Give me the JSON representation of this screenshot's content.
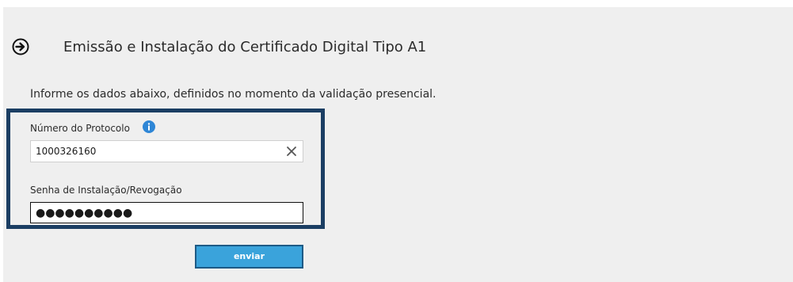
{
  "header": {
    "title": "Emissão e Instalação do Certificado Digital Tipo A1",
    "icon": "arrow-right-circle-icon"
  },
  "instruction": "Informe os dados abaixo, definidos no momento da validação presencial.",
  "form": {
    "protocol": {
      "label": "Número do Protocolo",
      "value": "1000326160",
      "info_icon": "info-icon",
      "clear_icon": "close-icon"
    },
    "password": {
      "label": "Senha de Instalação/Revogação",
      "masked_value": "●●●●●●●●●●"
    },
    "submit_label": "enviar"
  },
  "colors": {
    "panel_bg": "#efefef",
    "frame_border": "#1b3e63",
    "button_bg": "#3aa3db",
    "button_border": "#1d5a85",
    "info_blue": "#2e86d6"
  }
}
